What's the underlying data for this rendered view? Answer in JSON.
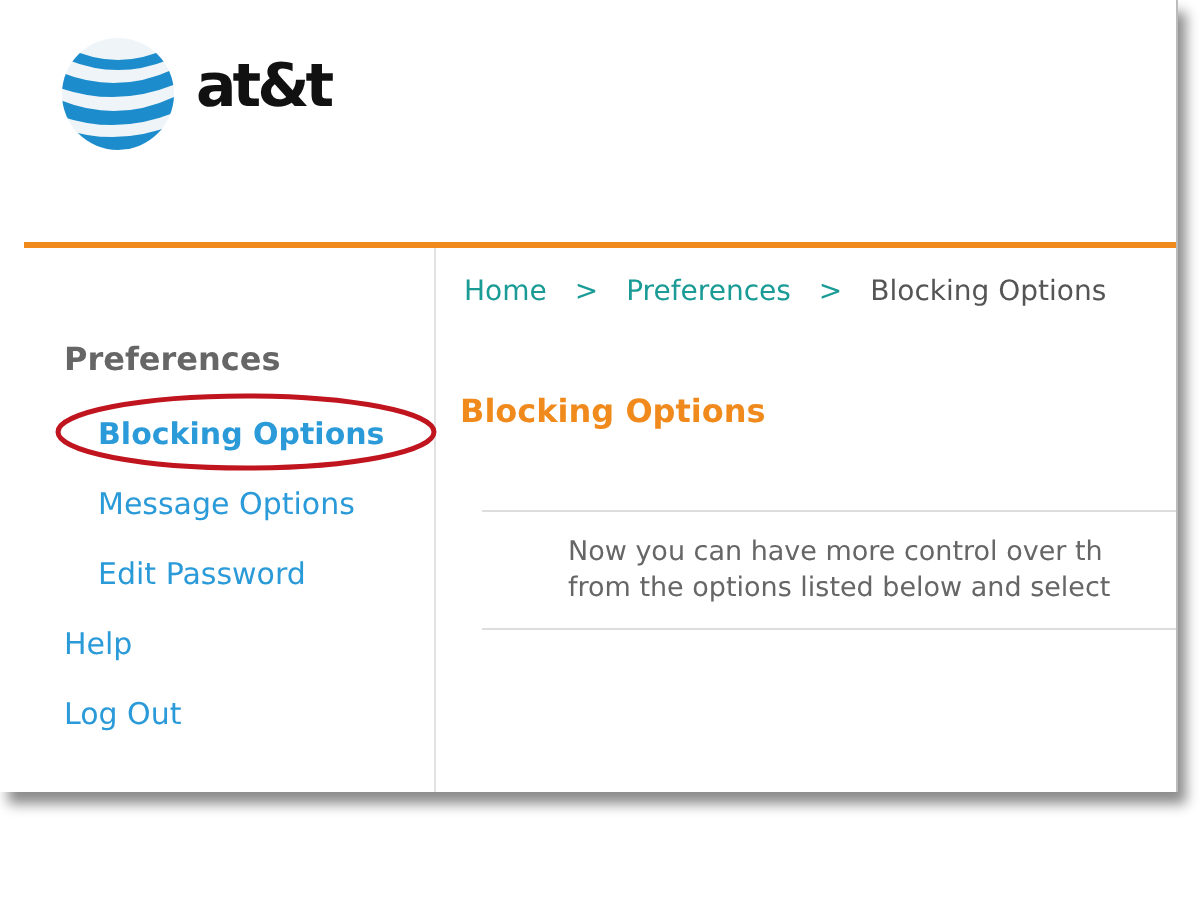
{
  "header": {
    "brand": "at&t"
  },
  "sidebar": {
    "heading": "Preferences",
    "items": [
      {
        "label": "Blocking Options",
        "sub": true,
        "selected": true,
        "circled": true
      },
      {
        "label": "Message Options",
        "sub": true,
        "selected": false,
        "circled": false
      },
      {
        "label": "Edit Password",
        "sub": true,
        "selected": false,
        "circled": false
      },
      {
        "label": "Help",
        "sub": false,
        "selected": false,
        "circled": false
      },
      {
        "label": "Log Out",
        "sub": false,
        "selected": false,
        "circled": false
      }
    ]
  },
  "breadcrumb": [
    {
      "label": "Home",
      "current": false
    },
    {
      "label": "Preferences",
      "current": false
    },
    {
      "label": "Blocking Options",
      "current": true
    }
  ],
  "breadcrumb_separator": ">",
  "title": "Blocking Options",
  "intro_lines": [
    "Now you can have more control over th",
    "from the options listed below and select"
  ]
}
